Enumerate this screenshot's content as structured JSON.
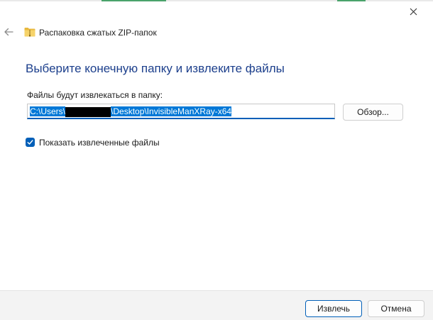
{
  "window": {
    "title": "Распаковка сжатых ZIP-папок"
  },
  "main": {
    "heading": "Выберите конечную папку и извлеките файлы",
    "path_label": "Файлы будут извлекаться в папку:",
    "path_prefix": "C:\\Users\\",
    "path_suffix": "\\Desktop\\InvisibleManXRay-x64",
    "browse_label": "Обзор...",
    "show_files_label": "Показать извлеченные файлы",
    "show_files_checked": true
  },
  "footer": {
    "extract_label": "Извлечь",
    "cancel_label": "Отмена"
  },
  "colors": {
    "accent": "#005fb8",
    "heading": "#1c3f8c",
    "selection": "#0078d7"
  },
  "icons": {
    "back": "back-arrow-icon",
    "folder": "zip-folder-icon",
    "close": "close-icon",
    "check": "checkmark-icon"
  }
}
